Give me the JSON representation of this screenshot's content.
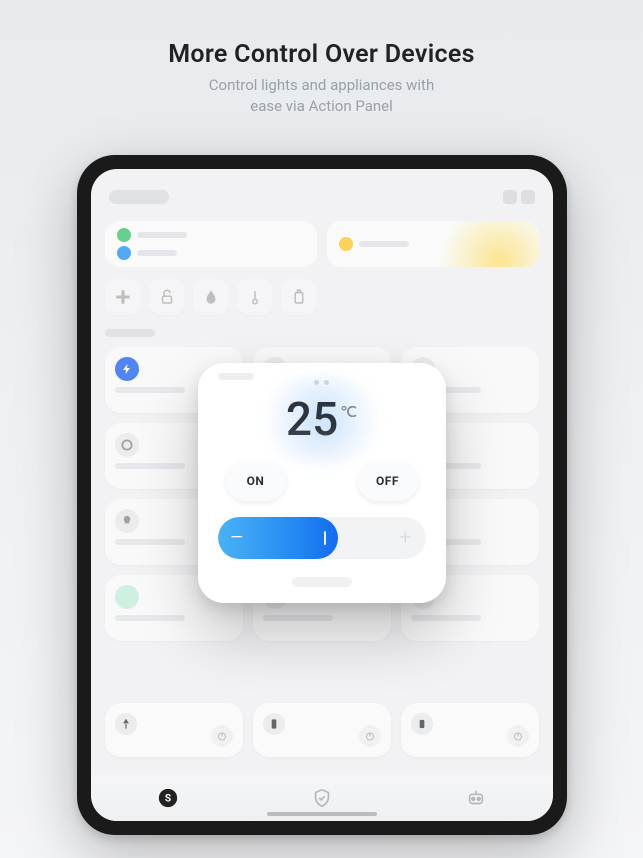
{
  "headline": {
    "title": "More Control Over Devices",
    "subtitle_line1": "Control lights and appliances with",
    "subtitle_line2": "ease via Action Panel"
  },
  "panel": {
    "temperature_value": "25",
    "temperature_unit": "℃",
    "on_label": "ON",
    "off_label": "OFF",
    "slider_minus": "−",
    "slider_plus": "+",
    "slider_percent": 58
  }
}
